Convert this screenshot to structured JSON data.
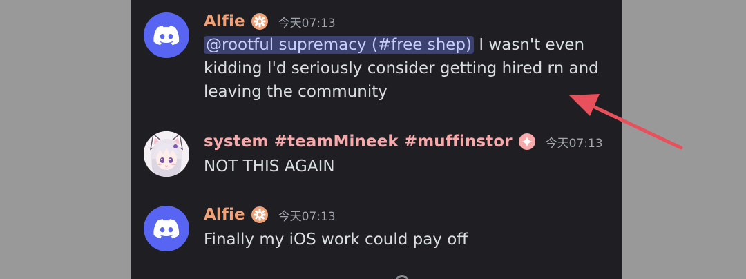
{
  "colors": {
    "background": "#999999",
    "chat_bg": "#1f1f23",
    "alfie_name": "#f0a178",
    "system_name": "#f8a9ab",
    "mention_bg": "#3c4270",
    "arrow": "#e8505b"
  },
  "messages": [
    {
      "author": "Alfie",
      "avatar": "discord-logo-icon",
      "badge": "gear-badge-icon",
      "time": "今天07:13",
      "mention": "@rootful supremacy (#free shep)",
      "text_line1": " I wasn't even",
      "text_line2": "kidding I'd seriously consider getting hired rn and",
      "text_line3": "leaving the community"
    },
    {
      "author": "system #teamMineek #muffinstor",
      "avatar": "anime-cat-girl-avatar",
      "badge": "sparkle-badge-icon",
      "time": "今天07:13",
      "text": "NOT THIS AGAIN"
    },
    {
      "author": "Alfie",
      "avatar": "discord-logo-icon",
      "badge": "gear-badge-icon",
      "time": "今天07:13",
      "text": "Finally my iOS work could pay off"
    }
  ],
  "annotation": {
    "type": "red-arrow"
  }
}
